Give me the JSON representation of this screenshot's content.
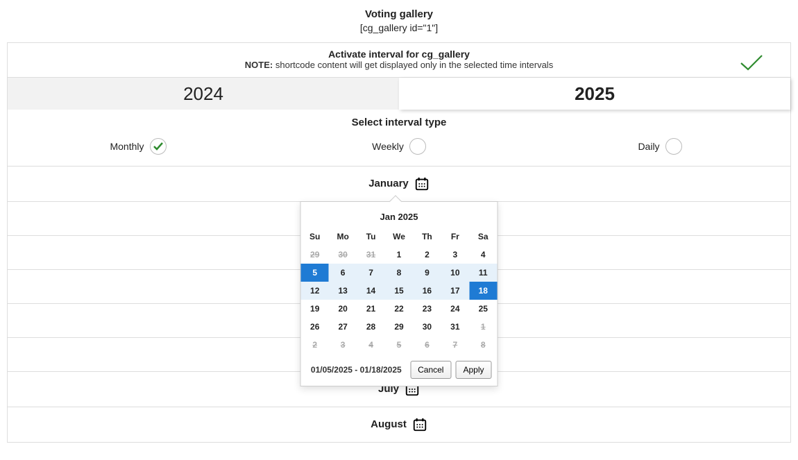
{
  "title": "Voting gallery",
  "shortcode": "[cg_gallery id=\"1\"]",
  "activate": {
    "heading": "Activate interval for cg_gallery",
    "note_prefix": "NOTE:",
    "note_text": " shortcode content will get displayed only in the selected time intervals"
  },
  "years": [
    {
      "label": "2024",
      "active": false
    },
    {
      "label": "2025",
      "active": true
    }
  ],
  "interval_label": "Select interval type",
  "interval_types": {
    "monthly": {
      "label": "Monthly",
      "selected": true
    },
    "weekly": {
      "label": "Weekly",
      "selected": false
    },
    "daily": {
      "label": "Daily",
      "selected": false
    }
  },
  "month_rows": {
    "january": "January",
    "july": "July",
    "august": "August"
  },
  "datepicker": {
    "header": "Jan 2025",
    "dow": [
      "Su",
      "Mo",
      "Tu",
      "We",
      "Th",
      "Fr",
      "Sa"
    ],
    "weeks": [
      [
        {
          "n": "29",
          "off": true
        },
        {
          "n": "30",
          "off": true
        },
        {
          "n": "31",
          "off": true
        },
        {
          "n": "1"
        },
        {
          "n": "2"
        },
        {
          "n": "3"
        },
        {
          "n": "4"
        }
      ],
      [
        {
          "n": "5",
          "start": true
        },
        {
          "n": "6",
          "in": true
        },
        {
          "n": "7",
          "in": true
        },
        {
          "n": "8",
          "in": true
        },
        {
          "n": "9",
          "in": true
        },
        {
          "n": "10",
          "in": true
        },
        {
          "n": "11",
          "in": true
        }
      ],
      [
        {
          "n": "12",
          "in": true
        },
        {
          "n": "13",
          "in": true
        },
        {
          "n": "14",
          "in": true
        },
        {
          "n": "15",
          "in": true
        },
        {
          "n": "16",
          "in": true
        },
        {
          "n": "17",
          "in": true
        },
        {
          "n": "18",
          "end": true
        }
      ],
      [
        {
          "n": "19"
        },
        {
          "n": "20"
        },
        {
          "n": "21"
        },
        {
          "n": "22"
        },
        {
          "n": "23"
        },
        {
          "n": "24"
        },
        {
          "n": "25"
        }
      ],
      [
        {
          "n": "26"
        },
        {
          "n": "27"
        },
        {
          "n": "28"
        },
        {
          "n": "29"
        },
        {
          "n": "30"
        },
        {
          "n": "31"
        },
        {
          "n": "1",
          "off": true
        }
      ],
      [
        {
          "n": "2",
          "off": true
        },
        {
          "n": "3",
          "off": true
        },
        {
          "n": "4",
          "off": true
        },
        {
          "n": "5",
          "off": true
        },
        {
          "n": "6",
          "off": true
        },
        {
          "n": "7",
          "off": true
        },
        {
          "n": "8",
          "off": true
        }
      ]
    ],
    "range_text": "01/05/2025 - 01/18/2025",
    "cancel": "Cancel",
    "apply": "Apply"
  }
}
